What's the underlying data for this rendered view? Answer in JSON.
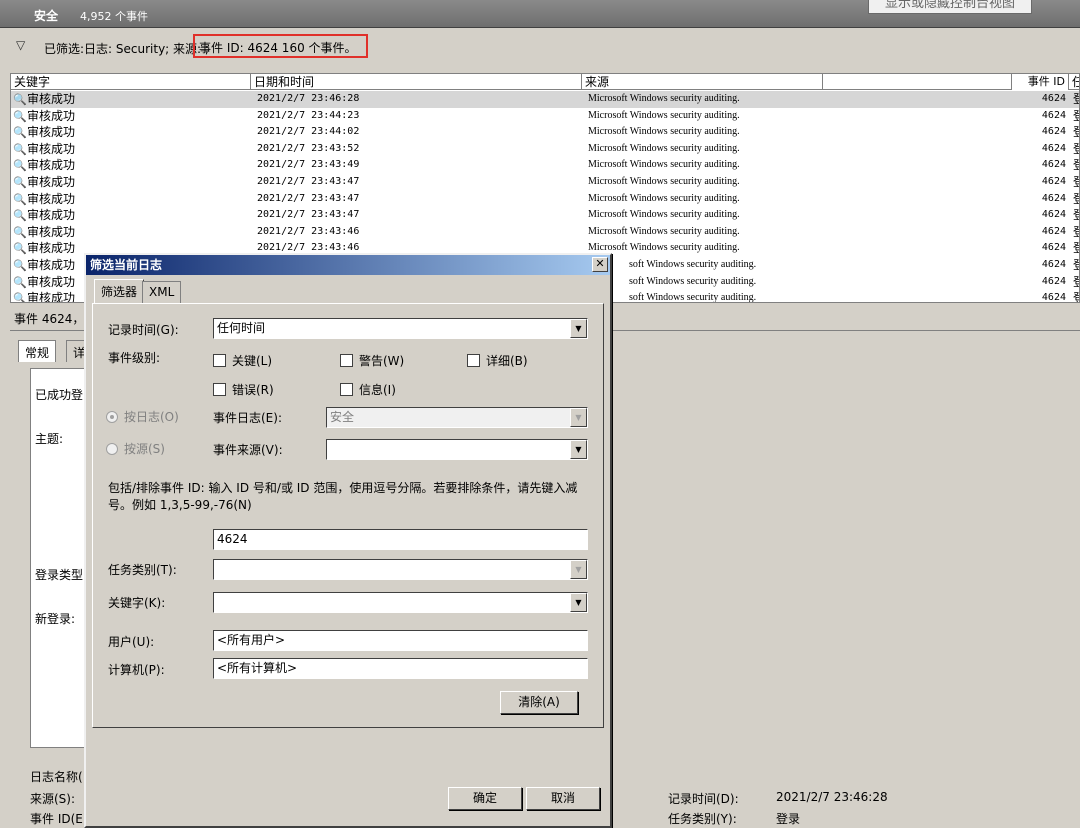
{
  "header": {
    "title": "安全",
    "event_count": "4,952 个事件",
    "show_hide_button": "显示或隐藏控制台视图"
  },
  "filter_bar": {
    "prefix": "已筛选:日志: Security; 来源: ;",
    "highlight": "事件 ID: 4624 160 个事件。"
  },
  "grid": {
    "columns": [
      "关键字",
      "日期和时间",
      "来源",
      "",
      "事件 ID",
      "任"
    ],
    "rows": [
      {
        "keyword": "审核成功",
        "datetime": "2021/2/7 23:46:28",
        "source": "Microsoft Windows security auditing.",
        "id": "4624",
        "cat": "登"
      },
      {
        "keyword": "审核成功",
        "datetime": "2021/2/7 23:44:23",
        "source": "Microsoft Windows security auditing.",
        "id": "4624",
        "cat": "登"
      },
      {
        "keyword": "审核成功",
        "datetime": "2021/2/7 23:44:02",
        "source": "Microsoft Windows security auditing.",
        "id": "4624",
        "cat": "登"
      },
      {
        "keyword": "审核成功",
        "datetime": "2021/2/7 23:43:52",
        "source": "Microsoft Windows security auditing.",
        "id": "4624",
        "cat": "登"
      },
      {
        "keyword": "审核成功",
        "datetime": "2021/2/7 23:43:49",
        "source": "Microsoft Windows security auditing.",
        "id": "4624",
        "cat": "登"
      },
      {
        "keyword": "审核成功",
        "datetime": "2021/2/7 23:43:47",
        "source": "Microsoft Windows security auditing.",
        "id": "4624",
        "cat": "登"
      },
      {
        "keyword": "审核成功",
        "datetime": "2021/2/7 23:43:47",
        "source": "Microsoft Windows security auditing.",
        "id": "4624",
        "cat": "登"
      },
      {
        "keyword": "审核成功",
        "datetime": "2021/2/7 23:43:47",
        "source": "Microsoft Windows security auditing.",
        "id": "4624",
        "cat": "登"
      },
      {
        "keyword": "审核成功",
        "datetime": "2021/2/7 23:43:46",
        "source": "Microsoft Windows security auditing.",
        "id": "4624",
        "cat": "登"
      },
      {
        "keyword": "审核成功",
        "datetime": "2021/2/7 23:43:46",
        "source": "Microsoft Windows security auditing.",
        "id": "4624",
        "cat": "登"
      },
      {
        "keyword": "审核成功",
        "datetime": "",
        "source": "soft Windows security auditing.",
        "id": "4624",
        "cat": "登"
      },
      {
        "keyword": "审核成功",
        "datetime": "",
        "source": "soft Windows security auditing.",
        "id": "4624",
        "cat": "登"
      },
      {
        "keyword": "审核成功",
        "datetime": "",
        "source": "soft Windows security auditing.",
        "id": "4624",
        "cat": "登"
      }
    ]
  },
  "lower": {
    "event_title": "事件 4624，M",
    "tab_general": "常规",
    "tab_detail": "详",
    "success_text": "已成功登",
    "subject": "主题:",
    "logon_type": "登录类型:",
    "new_logon": "新登录:",
    "log_name": "日志名称(",
    "source": "来源(S):",
    "event_id": "事件 ID(E)",
    "record_time_label": "记录时间(D):",
    "record_time_value": "2021/2/7 23:46:28",
    "task_category_label": "任务类别(Y):",
    "task_category_value": "登录"
  },
  "dialog": {
    "title": "筛选当前日志",
    "tab_filter": "筛选器",
    "tab_xml": "XML",
    "logged_label": "记录时间(G):",
    "logged_value": "任何时间",
    "level_label": "事件级别:",
    "critical": "关键(L)",
    "warning": "警告(W)",
    "verbose": "详细(B)",
    "error": "错误(R)",
    "information": "信息(I)",
    "by_log": "按日志(O)",
    "event_logs_label": "事件日志(E):",
    "event_logs_value": "安全",
    "by_source": "按源(S)",
    "event_sources_label": "事件来源(V):",
    "event_sources_value": "",
    "id_description": "包括/排除事件 ID: 输入 ID 号和/或 ID 范围，使用逗号分隔。若要排除条件，请先键入减号。例如 1,3,5-99,-76(N)",
    "event_id_value": "4624",
    "task_category_label": "任务类别(T):",
    "keywords_label": "关键字(K):",
    "user_label": "用户(U):",
    "user_value": "<所有用户>",
    "computer_label": "计算机(P):",
    "computer_value": "<所有计算机>",
    "clear_button": "清除(A)",
    "ok_button": "确定",
    "cancel_button": "取消"
  }
}
